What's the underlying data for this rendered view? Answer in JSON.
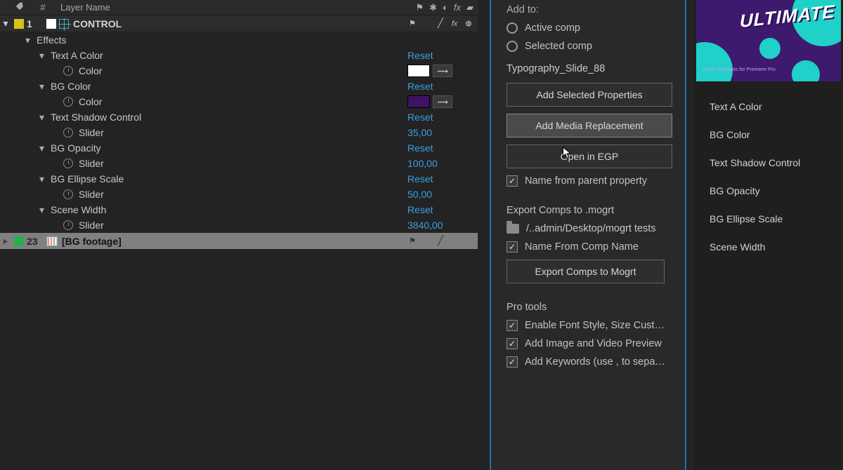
{
  "timeline": {
    "header": {
      "num": "#",
      "name": "Layer Name"
    },
    "layers": [
      {
        "index": "1",
        "name": "CONTROL",
        "color": "#d6c218"
      },
      {
        "index": "23",
        "name": "[BG footage]",
        "color": "#26b04b"
      }
    ],
    "effects_label": "Effects",
    "effects": [
      {
        "name": "Text A Color",
        "reset": "Reset",
        "sub": "Color",
        "swatch": "#ffffff"
      },
      {
        "name": "BG Color",
        "reset": "Reset",
        "sub": "Color",
        "swatch": "#3d1463"
      },
      {
        "name": "Text Shadow Control",
        "reset": "Reset",
        "sub": "Slider",
        "value": "35,00"
      },
      {
        "name": "BG Opacity",
        "reset": "Reset",
        "sub": "Slider",
        "value": "100,00"
      },
      {
        "name": "BG Ellipse Scale",
        "reset": "Reset",
        "sub": "Slider",
        "value": "50,00"
      },
      {
        "name": "Scene Width",
        "reset": "Reset",
        "sub": "Slider",
        "value": "3840,00"
      }
    ]
  },
  "mid": {
    "add_to": "Add to:",
    "radio_active": "Active comp",
    "radio_selected": "Selected comp",
    "comp_name": "Typography_Slide_88",
    "btn_add_props": "Add Selected Properties",
    "btn_add_media": "Add Media Replacement",
    "btn_open_egp": "Open in EGP",
    "chk_name_parent": "Name from parent property",
    "export_title": "Export Comps to .mogrt",
    "folder_path": "/..admin/Desktop/mogrt tests",
    "chk_name_comp": "Name From Comp Name",
    "btn_export": "Export Comps to Mogrt",
    "pro_tools": "Pro tools",
    "chk_font": "Enable Font Style, Size Cust…",
    "chk_img": "Add Image and Video Preview",
    "chk_kw": "Add Keywords (use , to sepa…"
  },
  "right": {
    "preview_text": "ULTIMATE",
    "preview_tiny": "Mogrt Templates\nfor Premiere Pro",
    "items": [
      "Text A Color",
      "BG Color",
      "Text Shadow Control",
      "BG Opacity",
      "BG Ellipse Scale",
      "Scene Width"
    ]
  }
}
